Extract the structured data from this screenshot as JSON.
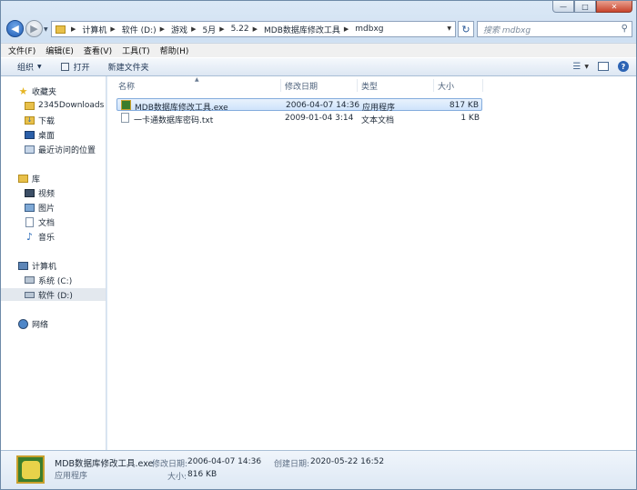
{
  "window": {
    "minimize": "—",
    "maximize": "□",
    "close": "✕"
  },
  "nav": {
    "breadcrumbs": [
      "计算机",
      "软件 (D:)",
      "游戏",
      "5月",
      "5.22",
      "MDB数据库修改工具",
      "mdbxg"
    ],
    "search_placeholder": "搜索 mdbxg"
  },
  "menubar": [
    "文件(F)",
    "编辑(E)",
    "查看(V)",
    "工具(T)",
    "帮助(H)"
  ],
  "toolbar": {
    "organize": "组织",
    "open": "打开",
    "new_folder": "新建文件夹"
  },
  "sidebar": {
    "favorites": {
      "label": "收藏夹",
      "items": [
        "2345Downloads",
        "下载",
        "桌面",
        "最近访问的位置"
      ]
    },
    "libraries": {
      "label": "库",
      "items": [
        "视频",
        "图片",
        "文档",
        "音乐"
      ]
    },
    "computer": {
      "label": "计算机",
      "items": [
        "系统 (C:)",
        "软件 (D:)"
      ]
    },
    "network": {
      "label": "网络"
    }
  },
  "columns": {
    "name": "名称",
    "date": "修改日期",
    "type": "类型",
    "size": "大小"
  },
  "files": [
    {
      "name": "MDB数据库修改工具.exe",
      "date": "2006-04-07 14:36",
      "type": "应用程序",
      "size": "817 KB",
      "icon": "exe-icon"
    },
    {
      "name": "一卡通数据库密码.txt",
      "date": "2009-01-04 3:14",
      "type": "文本文档",
      "size": "1 KB",
      "icon": "text-file-icon"
    }
  ],
  "details": {
    "name": "MDB数据库修改工具.exe",
    "kind": "应用程序",
    "modified_label": "修改日期:",
    "modified_value": "2006-04-07 14:36",
    "size_label": "大小:",
    "size_value": "816 KB",
    "created_label": "创建日期:",
    "created_value": "2020-05-22 16:52"
  }
}
